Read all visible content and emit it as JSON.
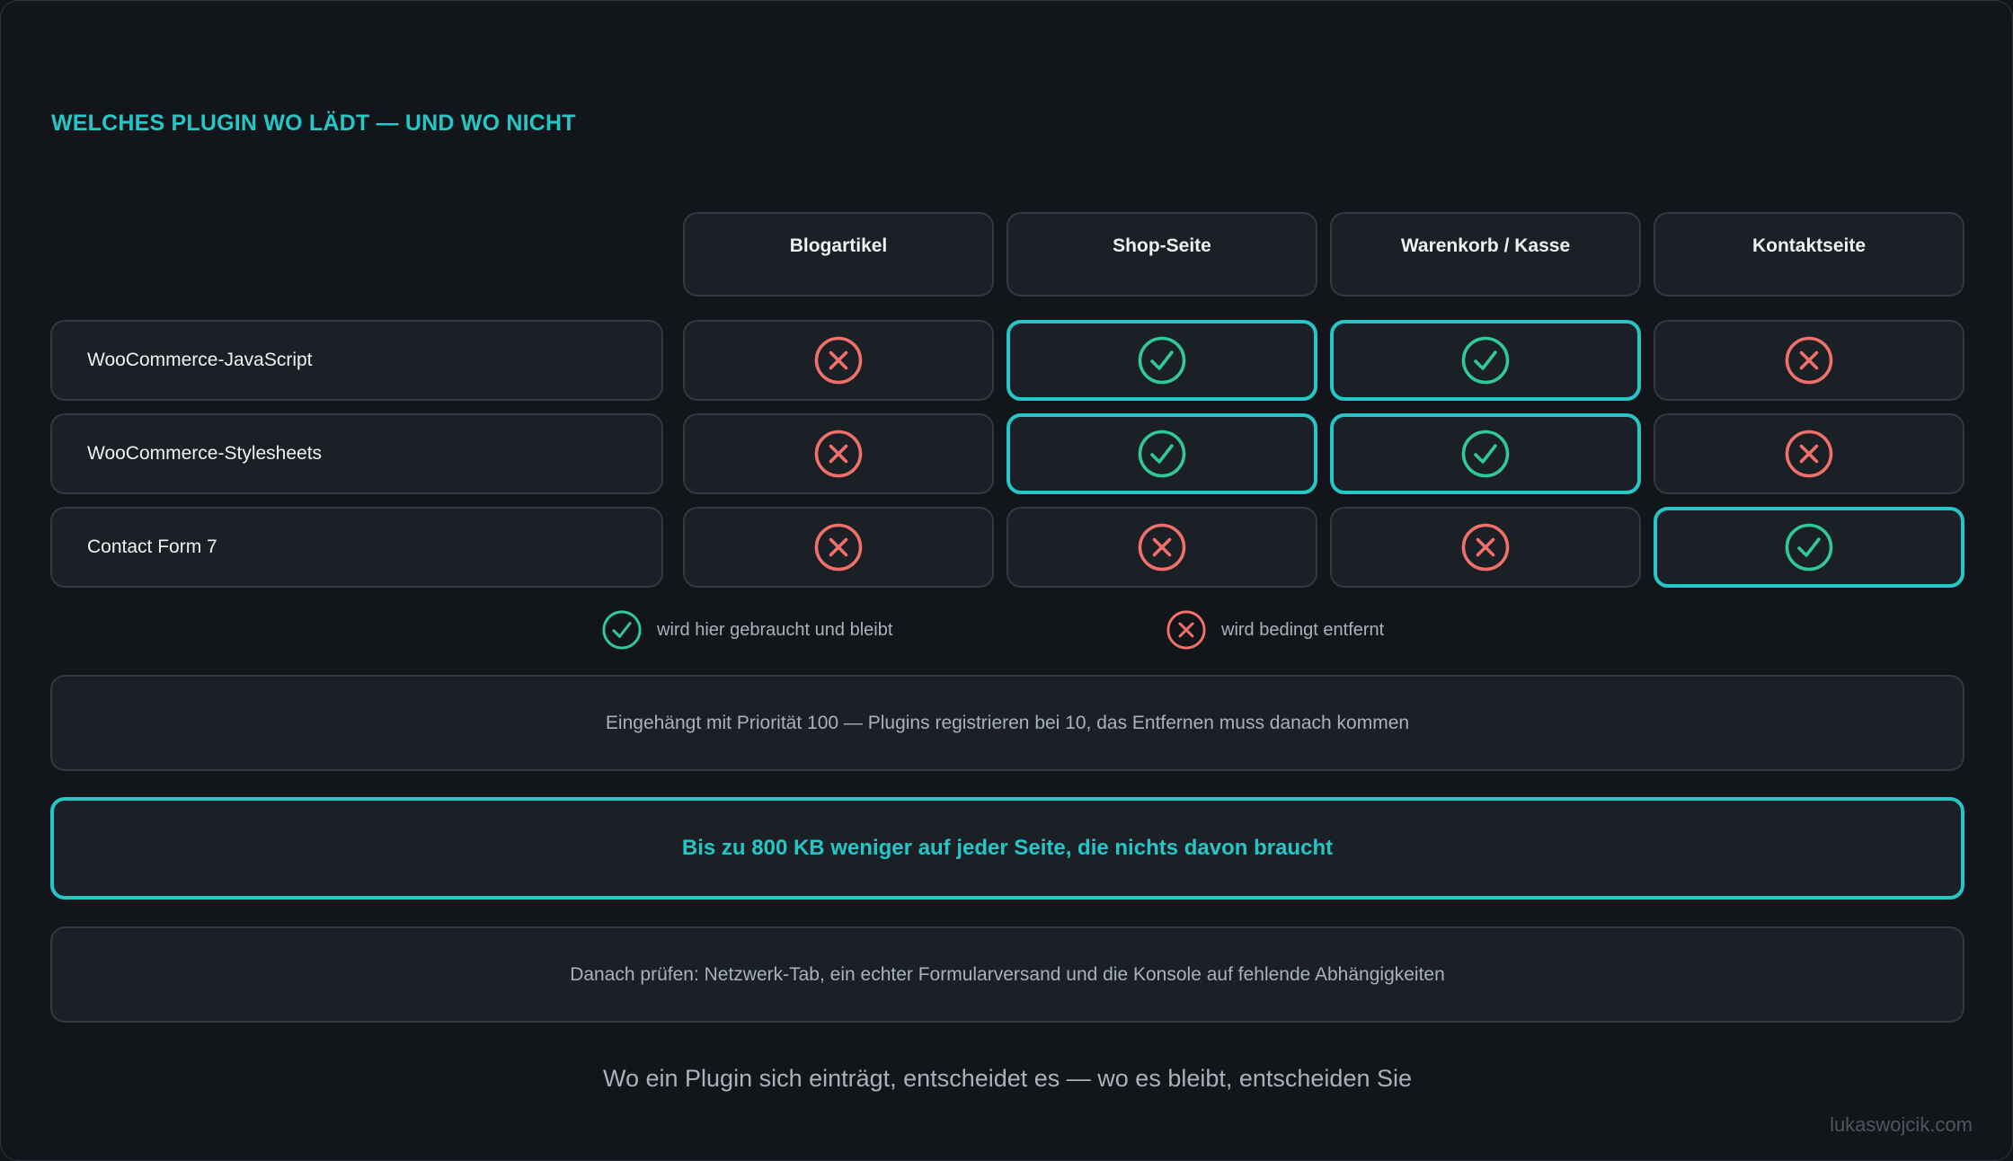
{
  "title": "WELCHES PLUGIN WO LÄDT — UND WO NICHT",
  "columns": [
    "Blogartikel",
    "Shop-Seite",
    "Warenkorb / Kasse",
    "Kontaktseite"
  ],
  "rows": [
    {
      "label": "WooCommerce-JavaScript",
      "loads": [
        false,
        true,
        true,
        false
      ]
    },
    {
      "label": "WooCommerce-Stylesheets",
      "loads": [
        false,
        true,
        true,
        false
      ]
    },
    {
      "label": "Contact Form 7",
      "loads": [
        false,
        false,
        false,
        true
      ]
    }
  ],
  "legend": {
    "keep": "wird hier gebraucht und bleibt",
    "remove": "wird bedingt entfernt"
  },
  "notes": {
    "priority": "Eingehängt mit Priorität 100 — Plugins registrieren bei 10, das Entfernen muss danach kommen",
    "savings": "Bis zu 800 KB weniger auf jeder Seite, die nichts davon braucht",
    "check": "Danach prüfen: Netzwerk-Tab, ein echter Formularversand und die Konsole auf fehlende Abhängigkeiten"
  },
  "footer": "Wo ein Plugin sich einträgt, entscheidet es — wo es bleibt, entscheiden Sie",
  "credit": "lukaswojcik.com",
  "colors": {
    "accent": "#26c6c6",
    "check": "#2fc99a",
    "cross": "#f0706a"
  },
  "icons": {
    "keep": "check-circle-icon",
    "remove": "x-circle-icon"
  }
}
